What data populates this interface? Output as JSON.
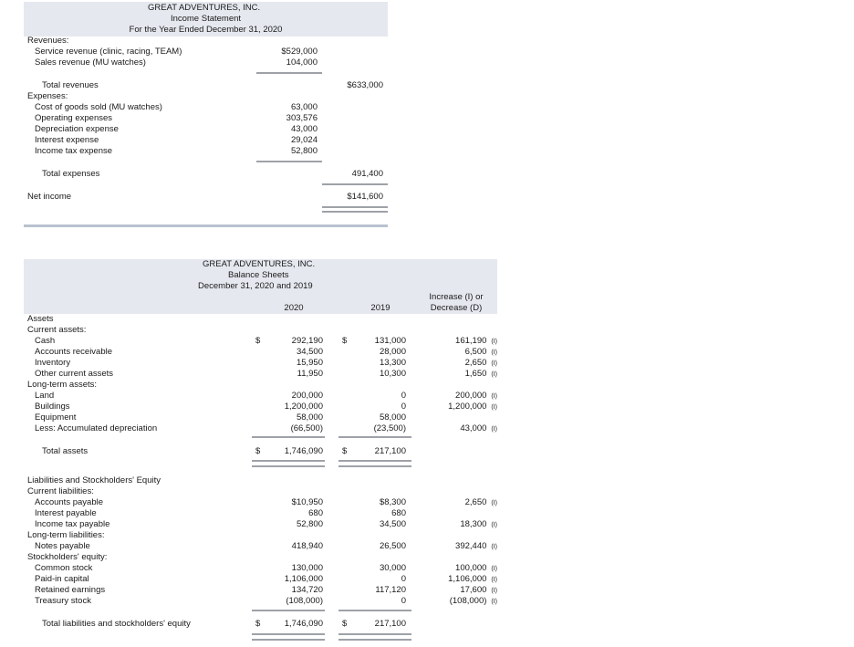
{
  "income": {
    "title": [
      "GREAT ADVENTURES, INC.",
      "Income Statement",
      "For the Year Ended December 31, 2020"
    ],
    "revenues_label": "Revenues:",
    "service_revenue": {
      "label": "Service revenue (clinic, racing, TEAM)",
      "value": "$529,000"
    },
    "sales_revenue": {
      "label": "Sales revenue (MU watches)",
      "value": "104,000"
    },
    "total_revenues": {
      "label": "Total revenues",
      "value": "$633,000"
    },
    "expenses_label": "Expenses:",
    "expenses": [
      {
        "label": "Cost of goods sold (MU watches)",
        "value": "63,000"
      },
      {
        "label": "Operating expenses",
        "value": "303,576"
      },
      {
        "label": "Depreciation expense",
        "value": "43,000"
      },
      {
        "label": "Interest expense",
        "value": "29,024"
      },
      {
        "label": "Income tax expense",
        "value": "52,800"
      }
    ],
    "total_expenses": {
      "label": "Total expenses",
      "value": "491,400"
    },
    "net_income": {
      "label": "Net income",
      "value": "$141,600"
    }
  },
  "balance": {
    "title": [
      "GREAT ADVENTURES, INC.",
      "Balance Sheets",
      "December 31, 2020 and 2019"
    ],
    "col_2020": "2020",
    "col_2019": "2019",
    "col_change": [
      "Increase (I) or",
      "Decrease (D)"
    ],
    "dollar": "$",
    "assets_label": "Assets",
    "current_assets_label": "Current assets:",
    "current_assets": [
      {
        "label": "Cash",
        "v2020": "292,190",
        "v2019": "131,000",
        "chg": "161,190",
        "flag": "(I)"
      },
      {
        "label": "Accounts receivable",
        "v2020": "34,500",
        "v2019": "28,000",
        "chg": "6,500",
        "flag": "(I)"
      },
      {
        "label": "Inventory",
        "v2020": "15,950",
        "v2019": "13,300",
        "chg": "2,650",
        "flag": "(I)"
      },
      {
        "label": "Other current assets",
        "v2020": "11,950",
        "v2019": "10,300",
        "chg": "1,650",
        "flag": "(I)"
      }
    ],
    "long_term_assets_label": "Long-term assets:",
    "long_term_assets": [
      {
        "label": "Land",
        "v2020": "200,000",
        "v2019": "0",
        "chg": "200,000",
        "flag": "(I)"
      },
      {
        "label": "Buildings",
        "v2020": "1,200,000",
        "v2019": "0",
        "chg": "1,200,000",
        "flag": "(I)"
      },
      {
        "label": "Equipment",
        "v2020": "58,000",
        "v2019": "58,000",
        "chg": "",
        "flag": ""
      },
      {
        "label": "Less: Accumulated depreciation",
        "v2020": "(66,500)",
        "v2019": "(23,500)",
        "chg": "43,000",
        "flag": "(I)"
      }
    ],
    "total_assets": {
      "label": "Total assets",
      "v2020": "1,746,090",
      "v2019": "217,100"
    },
    "liab_equity_label": "Liabilities and Stockholders' Equity",
    "current_liab_label": "Current liabilities:",
    "current_liabilities": [
      {
        "label": "Accounts payable",
        "v2020": "$10,950",
        "v2019": "$8,300",
        "chg": "2,650",
        "flag": "(I)"
      },
      {
        "label": "Interest payable",
        "v2020": "680",
        "v2019": "680",
        "chg": "",
        "flag": ""
      },
      {
        "label": "Income tax payable",
        "v2020": "52,800",
        "v2019": "34,500",
        "chg": "18,300",
        "flag": "(I)"
      }
    ],
    "long_term_liab_label": "Long-term liabilities:",
    "long_term_liabilities": [
      {
        "label": "Notes payable",
        "v2020": "418,940",
        "v2019": "26,500",
        "chg": "392,440",
        "flag": "(I)"
      }
    ],
    "equity_label": "Stockholders' equity:",
    "equity": [
      {
        "label": "Common stock",
        "v2020": "130,000",
        "v2019": "30,000",
        "chg": "100,000",
        "flag": "(I)"
      },
      {
        "label": "Paid-in capital",
        "v2020": "1,106,000",
        "v2019": "0",
        "chg": "1,106,000",
        "flag": "(I)"
      },
      {
        "label": "Retained earnings",
        "v2020": "134,720",
        "v2019": "117,120",
        "chg": "17,600",
        "flag": "(I)"
      },
      {
        "label": "Treasury stock",
        "v2020": "(108,000)",
        "v2019": "0",
        "chg": "(108,000)",
        "flag": "(I)"
      }
    ],
    "total_liab_equity": {
      "label": "Total liabilities and stockholders' equity",
      "v2020": "1,746,090",
      "v2019": "217,100"
    }
  }
}
